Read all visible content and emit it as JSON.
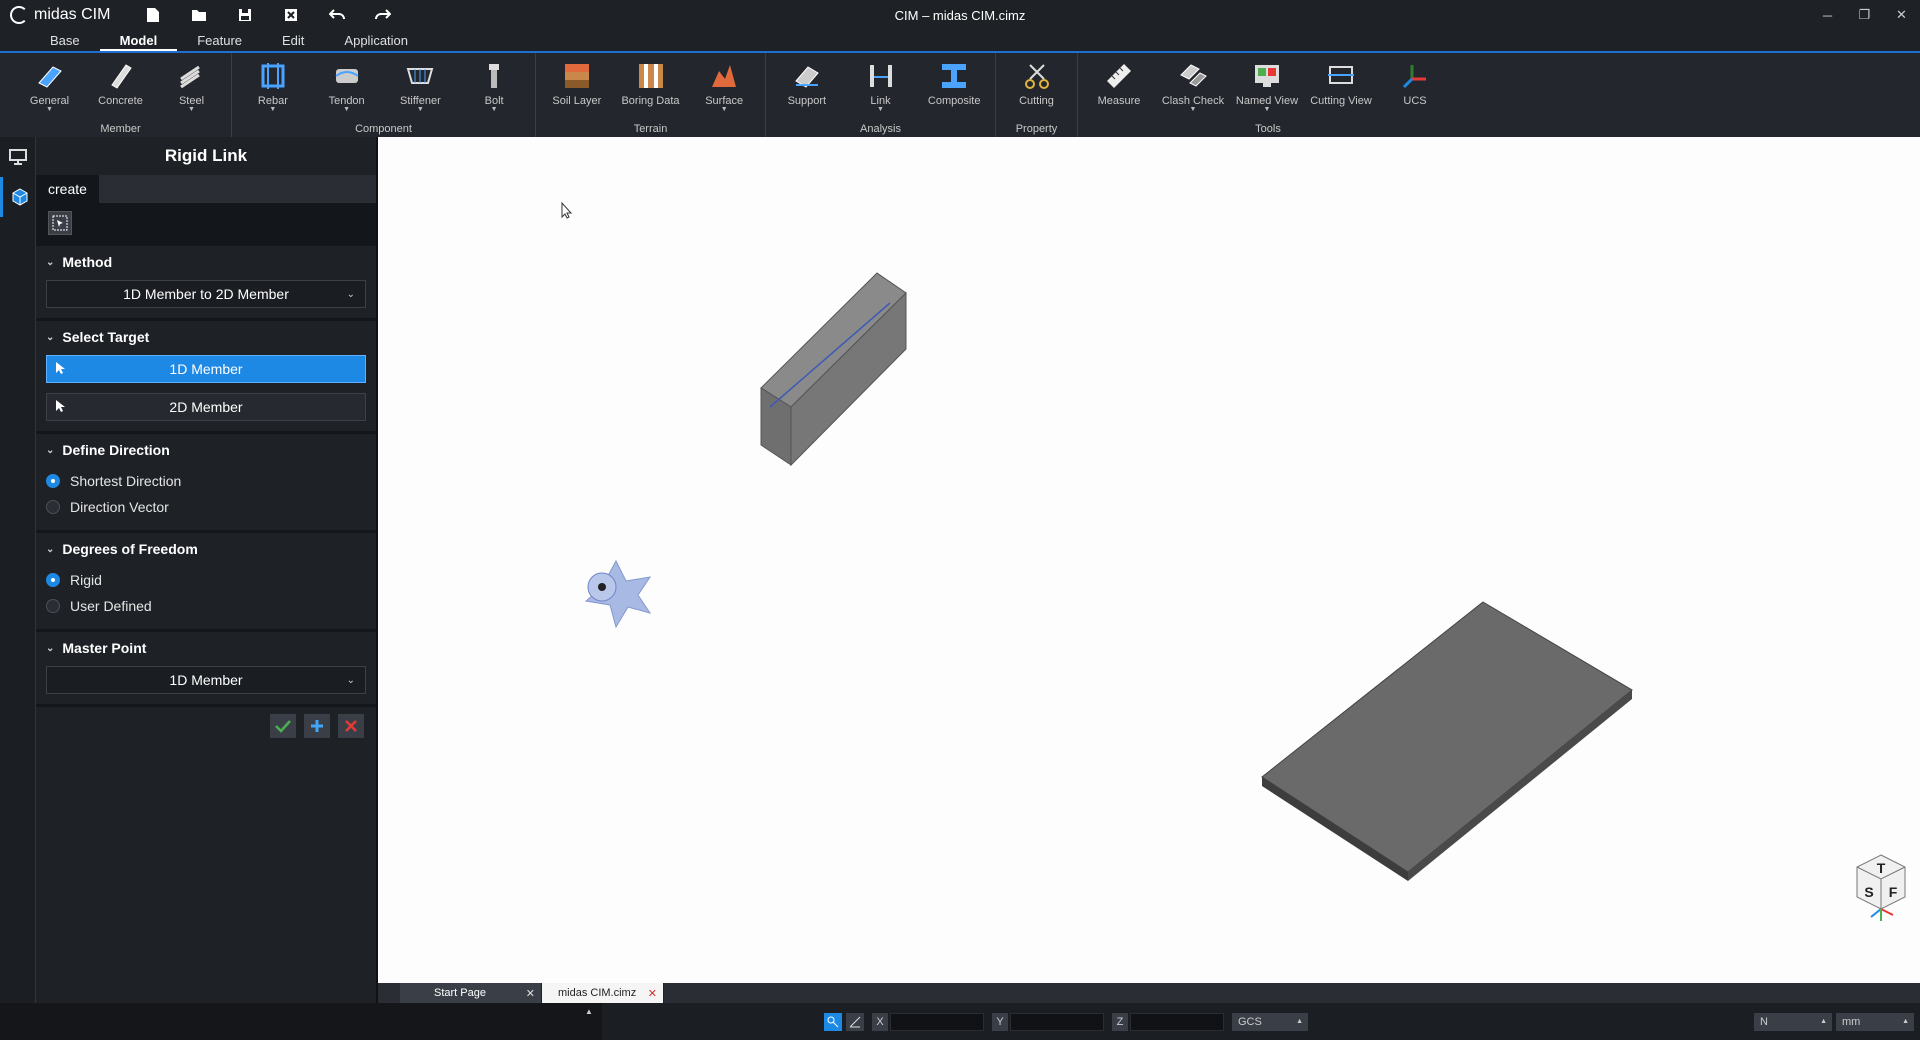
{
  "app": {
    "logo_text": "midas CIM",
    "window_title": "CIM – midas CIM.cimz",
    "window_controls": [
      "minimize-icon",
      "restore-icon",
      "close-icon"
    ]
  },
  "quick_access": [
    "new-file-icon",
    "open-folder-icon",
    "save-icon",
    "close-file-icon",
    "undo-icon",
    "redo-icon"
  ],
  "ribbon_tabs": [
    {
      "label": "Base",
      "active": false
    },
    {
      "label": "Model",
      "active": true
    },
    {
      "label": "Feature",
      "active": false
    },
    {
      "label": "Edit",
      "active": false
    },
    {
      "label": "Application",
      "active": false
    }
  ],
  "ribbon_groups": [
    {
      "label": "Member",
      "buttons": [
        {
          "label": "General",
          "icon": "general-member-icon",
          "caret": true
        },
        {
          "label": "Concrete",
          "icon": "concrete-icon",
          "caret": false
        },
        {
          "label": "Steel",
          "icon": "steel-icon",
          "caret": true
        }
      ]
    },
    {
      "label": "Component",
      "buttons": [
        {
          "label": "Rebar",
          "icon": "rebar-icon",
          "caret": true
        },
        {
          "label": "Tendon",
          "icon": "tendon-icon",
          "caret": true
        },
        {
          "label": "Stiffener",
          "icon": "stiffener-icon",
          "caret": true
        },
        {
          "label": "Bolt",
          "icon": "bolt-icon",
          "caret": true
        }
      ]
    },
    {
      "label": "Terrain",
      "buttons": [
        {
          "label": "Soil Layer",
          "icon": "soil-layer-icon",
          "caret": false
        },
        {
          "label": "Boring Data",
          "icon": "boring-data-icon",
          "caret": false
        },
        {
          "label": "Surface",
          "icon": "surface-icon",
          "caret": true
        }
      ]
    },
    {
      "label": "Analysis",
      "buttons": [
        {
          "label": "Support",
          "icon": "support-icon",
          "caret": false
        },
        {
          "label": "Link",
          "icon": "link-icon",
          "caret": true
        },
        {
          "label": "Composite",
          "icon": "composite-icon",
          "caret": false
        }
      ]
    },
    {
      "label": "Property",
      "buttons": [
        {
          "label": "Cutting",
          "icon": "cutting-icon",
          "caret": false
        }
      ]
    },
    {
      "label": "Tools",
      "buttons": [
        {
          "label": "Measure",
          "icon": "measure-icon",
          "caret": false
        },
        {
          "label": "Clash Check",
          "icon": "clash-check-icon",
          "caret": true
        },
        {
          "label": "Named View",
          "icon": "named-view-icon",
          "caret": true
        },
        {
          "label": "Cutting View",
          "icon": "cutting-view-icon",
          "caret": false
        },
        {
          "label": "UCS",
          "icon": "ucs-icon",
          "caret": false
        }
      ]
    }
  ],
  "panel": {
    "title": "Rigid Link",
    "tab": "create",
    "method": {
      "heading": "Method",
      "value": "1D Member to 2D Member"
    },
    "select_target": {
      "heading": "Select Target",
      "buttons": [
        {
          "label": "1D Member",
          "active": true
        },
        {
          "label": "2D Member",
          "active": false
        }
      ]
    },
    "define_direction": {
      "heading": "Define Direction",
      "options": [
        {
          "label": "Shortest Direction",
          "checked": true
        },
        {
          "label": "Direction Vector",
          "checked": false
        }
      ]
    },
    "dof": {
      "heading": "Degrees of Freedom",
      "options": [
        {
          "label": "Rigid",
          "checked": true
        },
        {
          "label": "User Defined",
          "checked": false
        }
      ]
    },
    "master_point": {
      "heading": "Master Point",
      "value": "1D Member"
    },
    "actions": [
      "apply-check-icon",
      "add-plus-icon",
      "cancel-x-icon"
    ]
  },
  "doc_tabs": [
    {
      "label": "Start Page",
      "active": false
    },
    {
      "label": "midas CIM.cimz",
      "active": true
    }
  ],
  "statusbar": {
    "x_label": "X",
    "y_label": "Y",
    "z_label": "Z",
    "x_value": "",
    "y_value": "",
    "z_value": "",
    "coord_system": "GCS",
    "force_unit": "N",
    "length_unit": "mm"
  },
  "navcube": {
    "faces": [
      "T",
      "S",
      "F"
    ]
  },
  "colors": {
    "accent": "#1e88e5",
    "viewport_bg": "#fdfdfd",
    "panel_bg": "#1e2227"
  }
}
